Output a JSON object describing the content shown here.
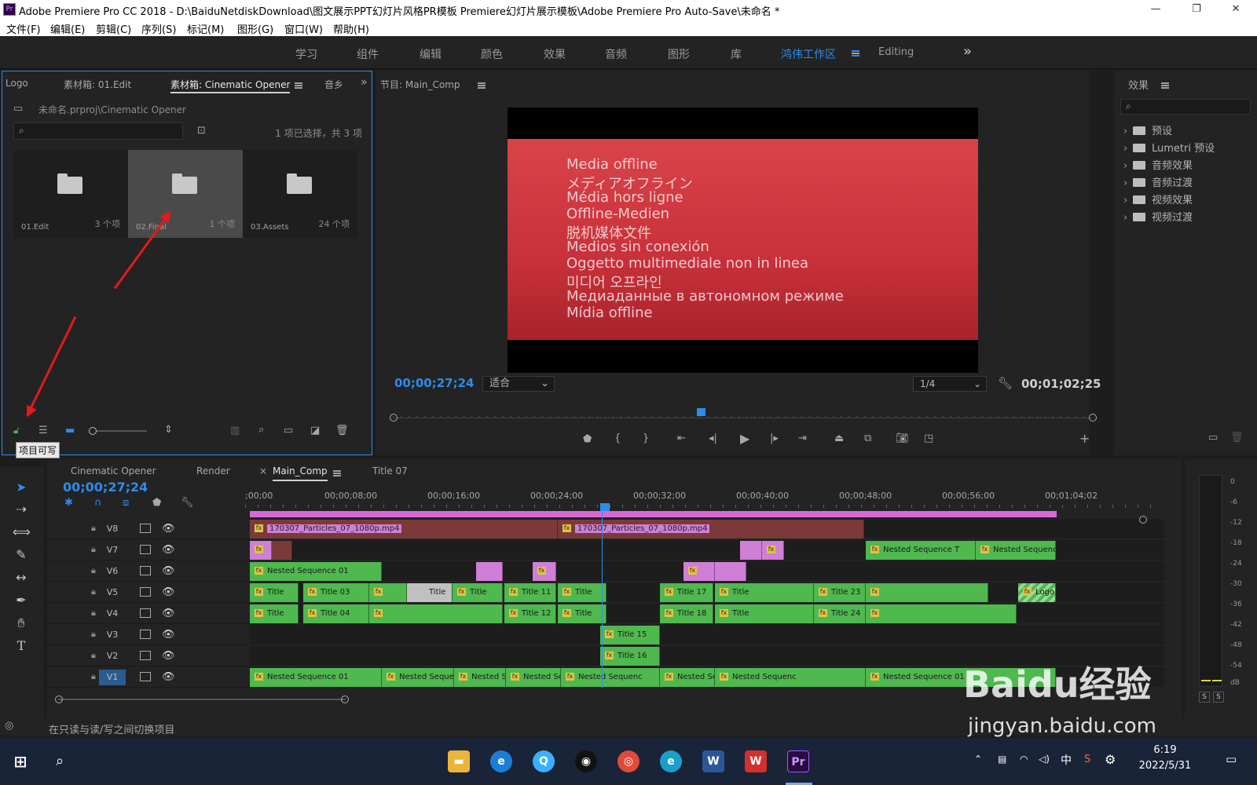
{
  "window": {
    "app_icon": "Pr",
    "title": "Adobe Premiere Pro CC 2018 - D:\\BaiduNetdiskDownload\\图文展示PPT幻灯片风格PR模板 Premiere幻灯片展示模板\\Adobe Premiere Pro Auto-Save\\未命名 *",
    "minimize": "—",
    "maximize": "❐",
    "close": "✕"
  },
  "menu": [
    "文件(F)",
    "编辑(E)",
    "剪辑(C)",
    "序列(S)",
    "标记(M)",
    "图形(G)",
    "窗口(W)",
    "帮助(H)"
  ],
  "workspaces": {
    "items": [
      "学习",
      "组件",
      "编辑",
      "颜色",
      "效果",
      "音频",
      "图形",
      "库",
      "鸿伟工作区",
      "Editing"
    ],
    "active": "鸿伟工作区",
    "more": "»"
  },
  "project_panel": {
    "tabs": [
      "Logo",
      "素材箱: 01.Edit",
      "素材箱: Cinematic Opener",
      "音乡"
    ],
    "path": "未命名.prproj\\Cinematic Opener",
    "selection_info": "1 项已选择，共 3 项",
    "bins": [
      {
        "name": "01.Edit",
        "count": "3 个项"
      },
      {
        "name": "02.Final",
        "count": "1 个项"
      },
      {
        "name": "03.Assets",
        "count": "24 个项"
      }
    ],
    "tooltip": "项目可写"
  },
  "program_monitor": {
    "tab": "节目: Main_Comp",
    "offline_lines": [
      "Media offline",
      "メディアオフライン",
      "Média hors ligne",
      "Offline-Medien",
      "脱机媒体文件",
      "Medios sin conexión",
      "Oggetto multimediale non in linea",
      "미디어 오프라인",
      "Медиаданные в автономном режиме",
      "Mídia offline"
    ],
    "timecode_current": "00;00;27;24",
    "fit": "适合",
    "resolution": "1/4",
    "timecode_duration": "00;01;02;25",
    "playhead_fraction": 0.44
  },
  "effects_panel": {
    "title": "效果",
    "items": [
      "预设",
      "Lumetri 预设",
      "音频效果",
      "音频过渡",
      "视频效果",
      "视频过渡"
    ]
  },
  "timeline": {
    "tabs": [
      "Cinematic Opener",
      "Render",
      "Main_Comp",
      "Title 07"
    ],
    "active_tab": "Main_Comp",
    "close_mark": "×",
    "timecode": "00;00;27;24",
    "ruler": [
      ";00;00",
      "00;00;08;00",
      "00;00;16;00",
      "00;00;24;00",
      "00;00;32;00",
      "00;00;40;00",
      "00;00;48;00",
      "00;00;56;00",
      "00;01;04;02"
    ],
    "tracks": [
      "V8",
      "V7",
      "V6",
      "V5",
      "V4",
      "V3",
      "V2",
      "V1"
    ],
    "clip_labels": {
      "particles": "170307_Particles_07_1080p.mp4",
      "nested": "Nested Sequence 01",
      "nested_short": "Nested Sequenc",
      "nested_t": "Nested Sequence T",
      "title03": "Title 03",
      "title04": "Title 04",
      "title11": "Title 11",
      "title12": "Title 12",
      "title15": "Title 15",
      "title16": "Title 16",
      "title17": "Title 17",
      "title18": "Title 18",
      "title23": "Title 23",
      "title24": "Title 24",
      "title": "Title",
      "logo": "Logo"
    }
  },
  "meter": {
    "db": [
      "0",
      "-6",
      "-12",
      "-18",
      "-24",
      "-30",
      "-36",
      "-42",
      "-48",
      "-54",
      "dB"
    ],
    "solo": "S"
  },
  "status_bar": {
    "text": "在只读与读/写之间切换项目"
  },
  "taskbar": {
    "time": "6:19",
    "date": "2022/5/31",
    "ime": "中"
  },
  "watermark": {
    "line1": "Baidu经验",
    "line2": "jingyan.baidu.com"
  },
  "colors": {
    "accent": "#2d8ceb",
    "clip_green": "#4fb84f",
    "clip_pink": "#cf7fd6",
    "arrow": "#e21b1b"
  }
}
